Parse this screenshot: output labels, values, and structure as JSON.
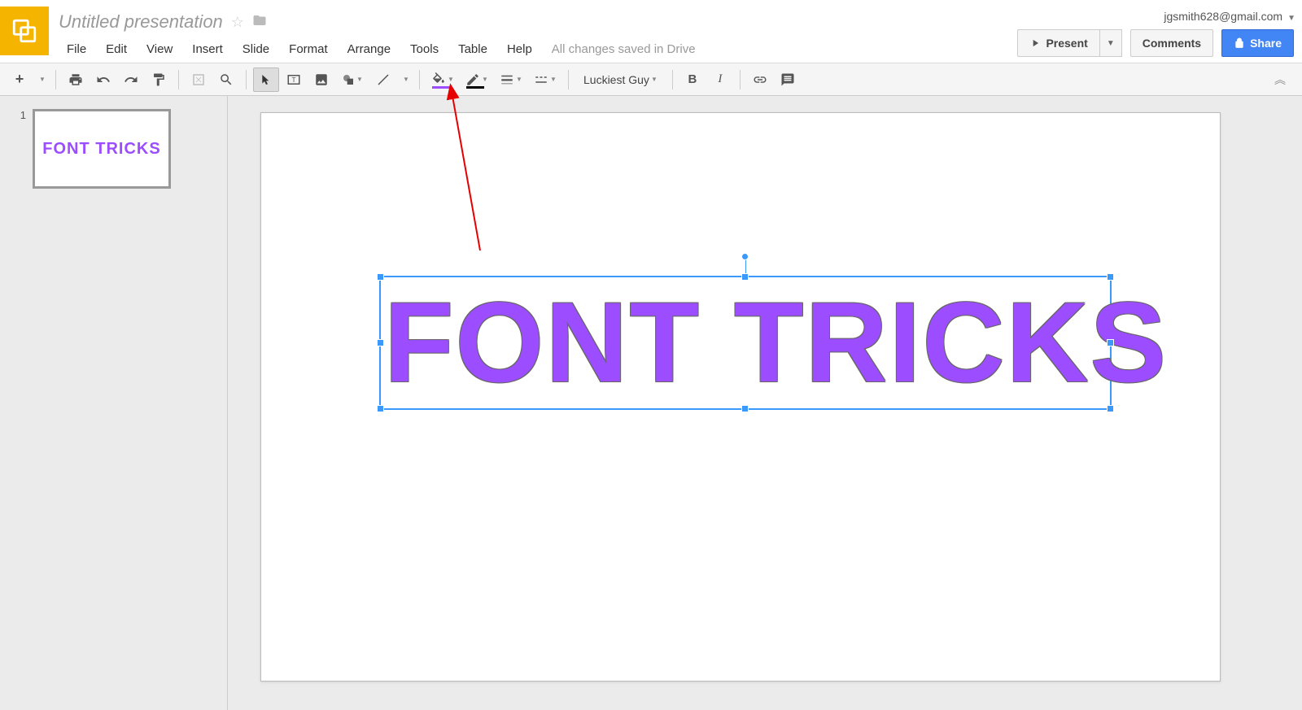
{
  "header": {
    "doc_title": "Untitled presentation",
    "user_email": "jgsmith628@gmail.com",
    "present_label": "Present",
    "comments_label": "Comments",
    "share_label": "Share"
  },
  "menubar": {
    "items": [
      "File",
      "Edit",
      "View",
      "Insert",
      "Slide",
      "Format",
      "Arrange",
      "Tools",
      "Table",
      "Help"
    ],
    "save_status": "All changes saved in Drive"
  },
  "toolbar": {
    "font_name": "Luckiest Guy",
    "fill_color": "#9b4dff",
    "line_color": "#000000"
  },
  "slidepanel": {
    "slides": [
      {
        "number": "1",
        "text": "FONT TRICKS"
      }
    ]
  },
  "canvas": {
    "main_text": "FONT TRICKS"
  }
}
